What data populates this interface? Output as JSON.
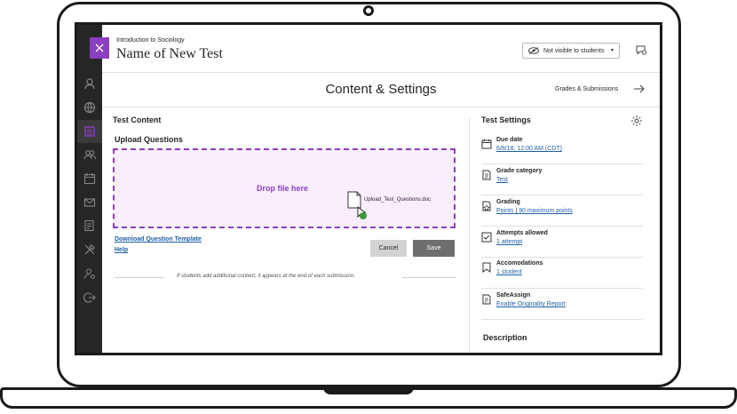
{
  "header": {
    "course_name": "Introduction to Sociology",
    "test_title": "Name of New Test",
    "visibility": "Not visible to students",
    "visibility_caret": "▾"
  },
  "subheader": {
    "title": "Content & Settings",
    "grades_link": "Grades & Submissions"
  },
  "sidebar": {
    "icons": [
      "person-icon",
      "globe-icon",
      "calendar-book-icon",
      "people-icon",
      "calendar-icon",
      "mail-icon",
      "notes-icon",
      "tools-icon",
      "user-settings-icon",
      "signout-icon"
    ]
  },
  "content": {
    "heading": "Test Content",
    "upload_heading": "Upload Questions",
    "drop_text": "Drop file here",
    "file_name": "Upload_Test_Questions.doc",
    "download_link": "Download Question Template",
    "help_link": "Help",
    "cancel_label": "Cancel",
    "save_label": "Save",
    "note": "If students add additional content, it appears at the end of each submission."
  },
  "settings": {
    "heading": "Test Settings",
    "items": [
      {
        "label": "Due date",
        "value": "6/8/18, 12:00 AM (CDT)"
      },
      {
        "label": "Grade category",
        "value": "Test"
      },
      {
        "label": "Grading",
        "value": "Points",
        "value2": "90 maximum points"
      },
      {
        "label": "Attempts allowed",
        "value": "1 attempt"
      },
      {
        "label": "Accomodations",
        "value": "1 student"
      },
      {
        "label": "SafeAssign",
        "value": "Enable Originality Report"
      }
    ],
    "description_heading": "Description"
  },
  "colors": {
    "accent": "#8b3fc1",
    "link": "#1f5fa6",
    "sidebar": "#262626"
  }
}
